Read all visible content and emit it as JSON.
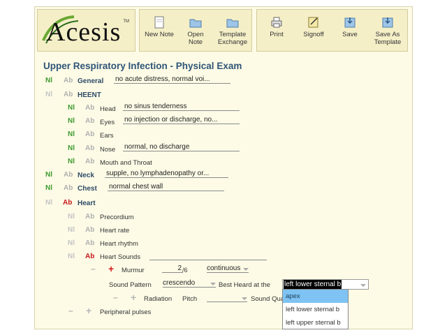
{
  "logo": {
    "text": "Acesis",
    "tm": "TM"
  },
  "toolbar": {
    "new_note": "New Note",
    "open_note": "Open Note",
    "template_exchange": "Template Exchange",
    "print": "Print",
    "signoff": "Signoff",
    "save": "Save",
    "save_as_template": "Save As Template"
  },
  "page_title": "Upper Respiratory Infection - Physical Exam",
  "nl": "Nl",
  "ab": "Ab",
  "exam": {
    "general": {
      "label": "General",
      "value": "no acute distress, normal voi..."
    },
    "heent": {
      "label": "HEENT"
    },
    "head": {
      "label": "Head",
      "value": "no sinus tenderness"
    },
    "eyes": {
      "label": "Eyes",
      "value": "no injection or discharge, no..."
    },
    "ears": {
      "label": "Ears"
    },
    "nose": {
      "label": "Nose",
      "value": "normal, no discharge"
    },
    "mouth": {
      "label": "Mouth and Throat"
    },
    "neck": {
      "label": "Neck",
      "value": "supple, no lymphadenopathy or..."
    },
    "chest": {
      "label": "Chest",
      "value": "normal chest wall"
    },
    "heart": {
      "label": "Heart"
    },
    "precordium": {
      "label": "Precordium"
    },
    "heart_rate": {
      "label": "Heart rate"
    },
    "heart_rhythm": {
      "label": "Heart rhythm"
    },
    "heart_sounds": {
      "label": "Heart Sounds"
    },
    "murmur": {
      "label": "Murmur",
      "grade": "2",
      "grade_suffix": "/6",
      "type": "continuous"
    },
    "sound_pattern": {
      "label": "Sound Pattern",
      "value": "crescendo"
    },
    "best_heard": {
      "label": "Best Heard at the",
      "value": "left lower sternal b"
    },
    "radiation": {
      "label": "Radiation"
    },
    "pitch": {
      "label": "Pitch",
      "value": ""
    },
    "sound_quality": {
      "label": "Sound Qua"
    },
    "peripheral_pulses": {
      "label": "Peripheral pulses"
    }
  },
  "dropdown_options": [
    "apex",
    "left lower sternal b",
    "left upper sternal b"
  ],
  "dropdown_highlight": "apex"
}
